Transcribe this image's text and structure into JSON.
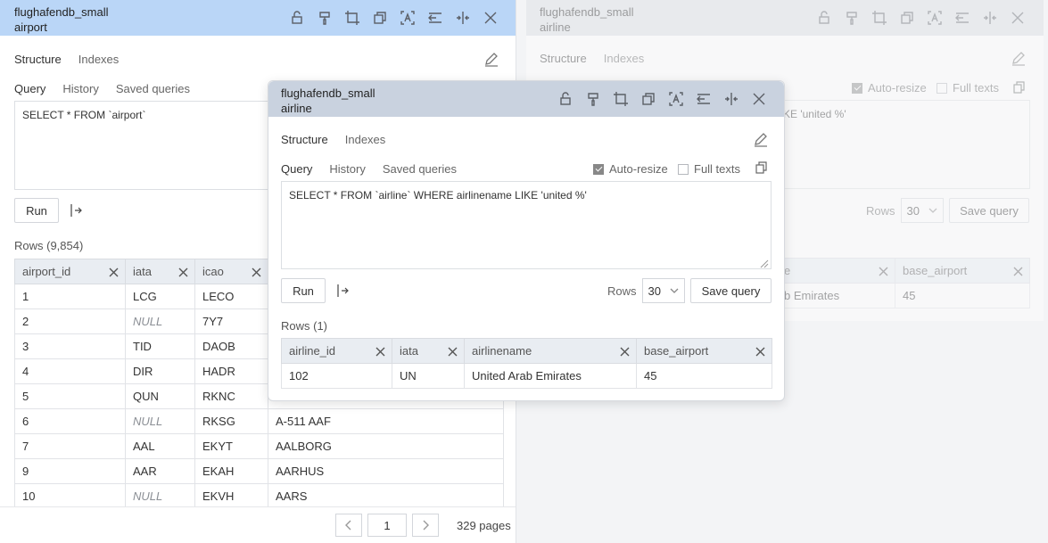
{
  "panel_airport": {
    "db": "flughafendb_small",
    "table": "airport",
    "tabs": [
      "Structure",
      "Indexes"
    ],
    "query_tabs": [
      "Query",
      "History",
      "Saved queries"
    ],
    "sql": "SELECT * FROM `airport`",
    "run_label": "Run",
    "rows_count": "Rows (9,854)",
    "columns": [
      "airport_id",
      "iata",
      "icao",
      ""
    ],
    "rows": [
      [
        "1",
        "LCG",
        "LECO",
        ""
      ],
      [
        "2",
        "NULL",
        "7Y7",
        ""
      ],
      [
        "3",
        "TID",
        "DAOB",
        ""
      ],
      [
        "4",
        "DIR",
        "HADR",
        ""
      ],
      [
        "5",
        "QUN",
        "RKNC",
        ""
      ],
      [
        "6",
        "NULL",
        "RKSG",
        "A-511 AAF"
      ],
      [
        "7",
        "AAL",
        "EKYT",
        "AALBORG"
      ],
      [
        "9",
        "AAR",
        "EKAH",
        "AARHUS"
      ],
      [
        "10",
        "NULL",
        "EKVH",
        "AARS"
      ]
    ],
    "page_current": "1",
    "pages_label": "329 pages"
  },
  "panel_airline_bg": {
    "db": "flughafendb_small",
    "table": "airline",
    "tabs": [
      "Structure",
      "Indexes"
    ],
    "auto_resize": "Auto-resize",
    "full_texts": "Full texts",
    "sql_fragment": "KE 'united %'",
    "rows_label": "Rows",
    "rows_value": "30",
    "save_query": "Save query",
    "columns": [
      "e",
      "base_airport"
    ],
    "row": [
      "b Emirates",
      "45"
    ]
  },
  "panel_airline": {
    "db": "flughafendb_small",
    "table": "airline",
    "tabs": [
      "Structure",
      "Indexes"
    ],
    "query_tabs": [
      "Query",
      "History",
      "Saved queries"
    ],
    "auto_resize": "Auto-resize",
    "full_texts": "Full texts",
    "sql": "SELECT * FROM `airline` WHERE airlinename LIKE 'united %'",
    "run_label": "Run",
    "rows_label": "Rows",
    "rows_value": "30",
    "save_query": "Save query",
    "rows_count": "Rows (1)",
    "columns": [
      "airline_id",
      "iata",
      "airlinename",
      "base_airport"
    ],
    "rows": [
      [
        "102",
        "UN",
        "United Arab Emirates",
        "45"
      ]
    ]
  },
  "icons": [
    "lock-open-icon",
    "paint-brush-icon",
    "crop-icon",
    "copy-icon",
    "font-icon",
    "indent-icon",
    "split-icon",
    "close-icon"
  ]
}
